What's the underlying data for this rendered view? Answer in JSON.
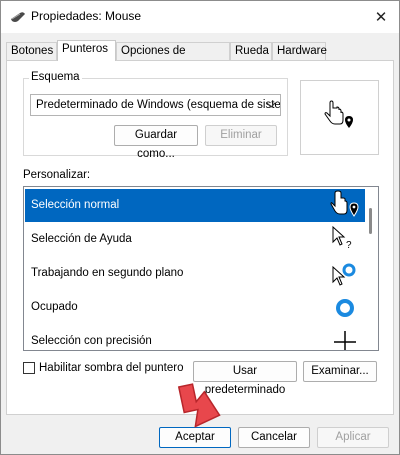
{
  "window": {
    "title": "Propiedades: Mouse",
    "close_glyph": "✕"
  },
  "tabs": [
    {
      "label": "Botones",
      "active": false
    },
    {
      "label": "Punteros",
      "active": true
    },
    {
      "label": "Opciones de puntero",
      "active": false
    },
    {
      "label": "Rueda",
      "active": false
    },
    {
      "label": "Hardware",
      "active": false
    }
  ],
  "scheme": {
    "group_label": "Esquema",
    "selected": "Predeterminado de Windows (esquema de siste",
    "save_label": "Guardar como...",
    "delete_label": "Eliminar"
  },
  "customize": {
    "label": "Personalizar:",
    "rows": [
      {
        "label": "Selección normal",
        "icon": "arrow-pointer-hand-icon",
        "selected": true
      },
      {
        "label": "Selección de Ayuda",
        "icon": "help-select-icon",
        "selected": false
      },
      {
        "label": "Trabajando en segundo plano",
        "icon": "working-background-icon",
        "selected": false
      },
      {
        "label": "Ocupado",
        "icon": "busy-icon",
        "selected": false
      },
      {
        "label": "Selección con precisión",
        "icon": "crosshair-icon",
        "selected": false
      }
    ]
  },
  "shadow_checkbox": {
    "label": "Habilitar sombra del puntero",
    "checked": false
  },
  "use_default_label": "Usar predeterminado",
  "browse_label": "Examinar...",
  "footer": {
    "ok": "Aceptar",
    "cancel": "Cancelar",
    "apply": "Aplicar"
  },
  "colors": {
    "selection": "#0067c0",
    "accent_arrow": "#e8474c",
    "busy": "#1b8ae0"
  }
}
